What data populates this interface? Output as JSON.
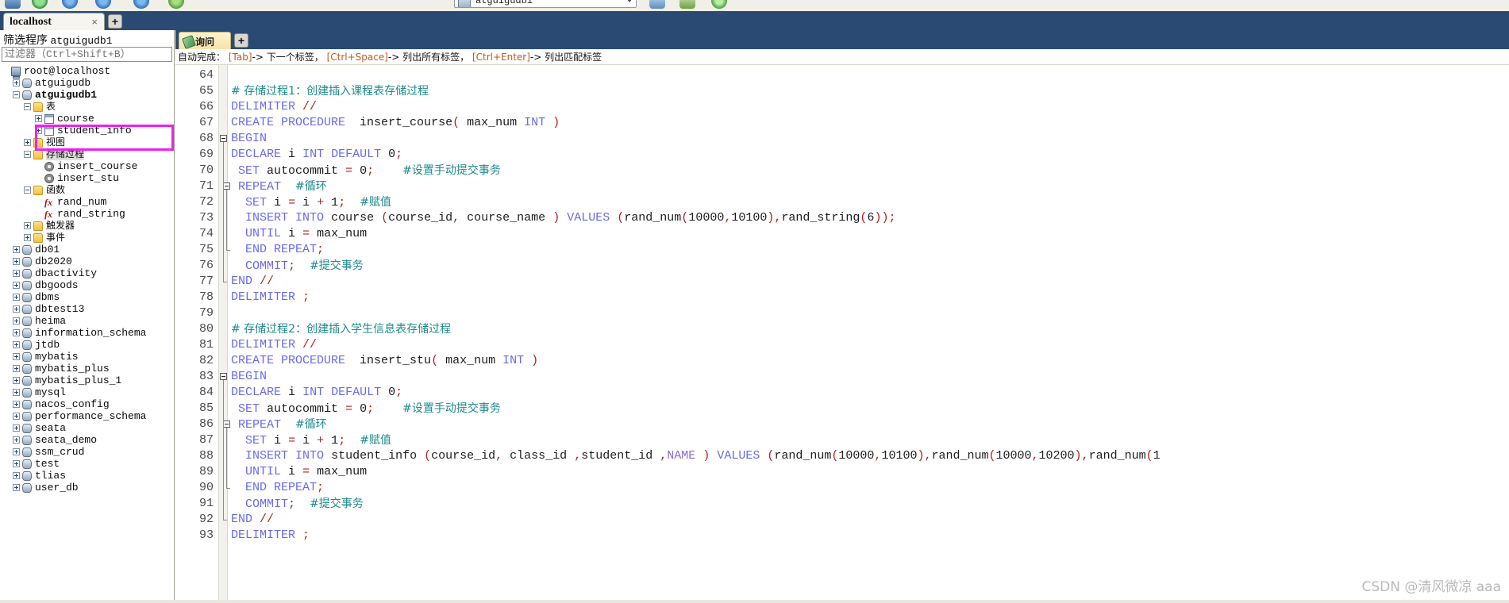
{
  "toolbar": {
    "db_combo_value": "atguigudb1",
    "icons": [
      "open-icon",
      "add-icon",
      "refresh-icon",
      "stop-icon",
      "back-icon",
      "sql-icon",
      "db-icon",
      "export-icon",
      "check-icon"
    ]
  },
  "browser_tab": {
    "label": "localhost",
    "close_label": "×",
    "new_tab_label": "+"
  },
  "sidebar": {
    "filter_title_prefix": "筛选程序",
    "filter_title_value": "atguigudb1",
    "filter_placeholder": "过滤器（Ctrl+Shift+B）",
    "filter_value": "",
    "tree": [
      {
        "label": "root@localhost",
        "indent": 0,
        "icon": "server-icon",
        "expander": "none",
        "bold": false,
        "cjk": false,
        "selected": false
      },
      {
        "label": "atguigudb",
        "indent": 1,
        "icon": "database-icon",
        "expander": "plus",
        "bold": false,
        "cjk": false,
        "selected": false
      },
      {
        "label": "atguigudb1",
        "indent": 1,
        "icon": "database-icon",
        "expander": "minus",
        "bold": true,
        "cjk": false,
        "selected": false
      },
      {
        "label": "表",
        "indent": 2,
        "icon": "folder-icon",
        "expander": "minus",
        "bold": false,
        "cjk": true,
        "selected": false
      },
      {
        "label": "course",
        "indent": 3,
        "icon": "table-icon",
        "expander": "plus",
        "bold": false,
        "cjk": false,
        "selected": false
      },
      {
        "label": "student_info",
        "indent": 3,
        "icon": "table-icon",
        "expander": "plus",
        "bold": false,
        "cjk": false,
        "selected": false
      },
      {
        "label": "视图",
        "indent": 2,
        "icon": "folder-icon",
        "expander": "plus",
        "bold": false,
        "cjk": true,
        "selected": false
      },
      {
        "label": "存储过程",
        "indent": 2,
        "icon": "folder-icon",
        "expander": "minus",
        "bold": false,
        "cjk": true,
        "selected": true
      },
      {
        "label": "insert_course",
        "indent": 3,
        "icon": "procedure-icon",
        "expander": "none",
        "bold": false,
        "cjk": false,
        "selected": false
      },
      {
        "label": "insert_stu",
        "indent": 3,
        "icon": "procedure-icon",
        "expander": "none",
        "bold": false,
        "cjk": false,
        "selected": false
      },
      {
        "label": "函数",
        "indent": 2,
        "icon": "folder-icon",
        "expander": "minus",
        "bold": false,
        "cjk": true,
        "selected": false
      },
      {
        "label": "rand_num",
        "indent": 3,
        "icon": "function-icon",
        "expander": "none",
        "bold": false,
        "cjk": false,
        "selected": false
      },
      {
        "label": "rand_string",
        "indent": 3,
        "icon": "function-icon",
        "expander": "none",
        "bold": false,
        "cjk": false,
        "selected": false
      },
      {
        "label": "触发器",
        "indent": 2,
        "icon": "folder-icon",
        "expander": "plus",
        "bold": false,
        "cjk": true,
        "selected": false
      },
      {
        "label": "事件",
        "indent": 2,
        "icon": "folder-icon",
        "expander": "plus",
        "bold": false,
        "cjk": true,
        "selected": false
      },
      {
        "label": "db01",
        "indent": 1,
        "icon": "database-icon",
        "expander": "plus",
        "bold": false,
        "cjk": false,
        "selected": false
      },
      {
        "label": "db2020",
        "indent": 1,
        "icon": "database-icon",
        "expander": "plus",
        "bold": false,
        "cjk": false,
        "selected": false
      },
      {
        "label": "dbactivity",
        "indent": 1,
        "icon": "database-icon",
        "expander": "plus",
        "bold": false,
        "cjk": false,
        "selected": false
      },
      {
        "label": "dbgoods",
        "indent": 1,
        "icon": "database-icon",
        "expander": "plus",
        "bold": false,
        "cjk": false,
        "selected": false
      },
      {
        "label": "dbms",
        "indent": 1,
        "icon": "database-icon",
        "expander": "plus",
        "bold": false,
        "cjk": false,
        "selected": false
      },
      {
        "label": "dbtest13",
        "indent": 1,
        "icon": "database-icon",
        "expander": "plus",
        "bold": false,
        "cjk": false,
        "selected": false
      },
      {
        "label": "heima",
        "indent": 1,
        "icon": "database-icon",
        "expander": "plus",
        "bold": false,
        "cjk": false,
        "selected": false
      },
      {
        "label": "information_schema",
        "indent": 1,
        "icon": "database-icon",
        "expander": "plus",
        "bold": false,
        "cjk": false,
        "selected": false
      },
      {
        "label": "jtdb",
        "indent": 1,
        "icon": "database-icon",
        "expander": "plus",
        "bold": false,
        "cjk": false,
        "selected": false
      },
      {
        "label": "mybatis",
        "indent": 1,
        "icon": "database-icon",
        "expander": "plus",
        "bold": false,
        "cjk": false,
        "selected": false
      },
      {
        "label": "mybatis_plus",
        "indent": 1,
        "icon": "database-icon",
        "expander": "plus",
        "bold": false,
        "cjk": false,
        "selected": false
      },
      {
        "label": "mybatis_plus_1",
        "indent": 1,
        "icon": "database-icon",
        "expander": "plus",
        "bold": false,
        "cjk": false,
        "selected": false
      },
      {
        "label": "mysql",
        "indent": 1,
        "icon": "database-icon",
        "expander": "plus",
        "bold": false,
        "cjk": false,
        "selected": false
      },
      {
        "label": "nacos_config",
        "indent": 1,
        "icon": "database-icon",
        "expander": "plus",
        "bold": false,
        "cjk": false,
        "selected": false
      },
      {
        "label": "performance_schema",
        "indent": 1,
        "icon": "database-icon",
        "expander": "plus",
        "bold": false,
        "cjk": false,
        "selected": false
      },
      {
        "label": "seata",
        "indent": 1,
        "icon": "database-icon",
        "expander": "plus",
        "bold": false,
        "cjk": false,
        "selected": false
      },
      {
        "label": "seata_demo",
        "indent": 1,
        "icon": "database-icon",
        "expander": "plus",
        "bold": false,
        "cjk": false,
        "selected": false
      },
      {
        "label": "ssm_crud",
        "indent": 1,
        "icon": "database-icon",
        "expander": "plus",
        "bold": false,
        "cjk": false,
        "selected": false
      },
      {
        "label": "test",
        "indent": 1,
        "icon": "database-icon",
        "expander": "plus",
        "bold": false,
        "cjk": false,
        "selected": false
      },
      {
        "label": "tlias",
        "indent": 1,
        "icon": "database-icon",
        "expander": "plus",
        "bold": false,
        "cjk": false,
        "selected": false
      },
      {
        "label": "user_db",
        "indent": 1,
        "icon": "database-icon",
        "expander": "plus",
        "bold": false,
        "cjk": false,
        "selected": false
      }
    ],
    "highlight_color": "#ec22ec"
  },
  "query_tab": {
    "label": "询问",
    "new_tab_label": "+"
  },
  "hint_bar": {
    "prefix": "自动完成：",
    "parts": [
      {
        "key": "[Tab]",
        "text": "-> 下一个标签，"
      },
      {
        "key": "[Ctrl+Space]",
        "text": "-> 列出所有标签，"
      },
      {
        "key": "[Ctrl+Enter]",
        "text": "-> 列出匹配标签"
      }
    ]
  },
  "editor": {
    "first_line_number": 64,
    "lines": [
      {
        "n": 64,
        "html": ""
      },
      {
        "n": 65,
        "html": "<span class=\"cmt\"># 存储过程1：创建插入课程表存储过程</span>"
      },
      {
        "n": 66,
        "html": "<span class=\"kw2\">DELIMITER</span> <span class=\"punc\">//</span>"
      },
      {
        "n": 67,
        "html": "<span class=\"kw2\">CREATE PROCEDURE</span>&nbsp;&nbsp;<span class=\"ident\">insert_course</span><span class=\"punc\">(</span> <span class=\"ident\">max_num</span> <span class=\"kw2\">INT</span> <span class=\"punc\">)</span>"
      },
      {
        "n": 68,
        "html": "<span class=\"kw2\">BEGIN</span>",
        "fold": "start"
      },
      {
        "n": 69,
        "html": "<span class=\"kw2\">DECLARE</span> <span class=\"ident\">i</span> <span class=\"kw2\">INT DEFAULT</span> <span class=\"ident\">0</span><span class=\"punc\">;</span>",
        "fold": "line"
      },
      {
        "n": 70,
        "html": "&nbsp;<span class=\"kw2\">SET</span> <span class=\"ident\">autocommit</span> <span class=\"punc\">=</span> <span class=\"ident\">0</span><span class=\"punc\">;</span>&nbsp;&nbsp;&nbsp;&nbsp;<span class=\"cmt\">#设置手动提交事务</span>",
        "fold": "line"
      },
      {
        "n": 71,
        "html": "&nbsp;<span class=\"kw2\">REPEAT</span>&nbsp;&nbsp;<span class=\"cmt\">#循环</span>",
        "fold": "start2"
      },
      {
        "n": 72,
        "html": "&nbsp;&nbsp;<span class=\"kw2\">SET</span> <span class=\"ident\">i</span> <span class=\"punc\">=</span> <span class=\"ident\">i</span> <span class=\"punc\">+</span> <span class=\"ident\">1</span><span class=\"punc\">;</span>&nbsp;&nbsp;<span class=\"cmt\">#赋值</span>",
        "fold": "line2"
      },
      {
        "n": 73,
        "html": "&nbsp;&nbsp;<span class=\"kw2\">INSERT INTO</span> <span class=\"ident\">course</span> <span class=\"punc\">(</span><span class=\"ident\">course_id</span><span class=\"punc\">,</span> <span class=\"ident\">course_name</span> <span class=\"punc\">)</span> <span class=\"kw2\">VALUES</span> <span class=\"punc\">(</span><span class=\"ident\">rand_num</span><span class=\"punc\">(</span><span class=\"ident\">10000</span><span class=\"punc\">,</span><span class=\"ident\">10100</span><span class=\"punc\">),</span><span class=\"ident\">rand_string</span><span class=\"punc\">(</span><span class=\"ident\">6</span><span class=\"punc\">));</span>",
        "fold": "line2"
      },
      {
        "n": 74,
        "html": "&nbsp;&nbsp;<span class=\"kw2\">UNTIL</span> <span class=\"ident\">i</span> <span class=\"punc\">=</span> <span class=\"ident\">max_num</span>",
        "fold": "line2"
      },
      {
        "n": 75,
        "html": "&nbsp;&nbsp;<span class=\"kw2\">END REPEAT</span><span class=\"punc\">;</span>",
        "fold": "end2"
      },
      {
        "n": 76,
        "html": "&nbsp;&nbsp;<span class=\"kw2\">COMMIT</span><span class=\"punc\">;</span>&nbsp;&nbsp;<span class=\"cmt\">#提交事务</span>",
        "fold": "line"
      },
      {
        "n": 77,
        "html": "<span class=\"kw2\">END</span> <span class=\"punc\">//</span>",
        "fold": "end"
      },
      {
        "n": 78,
        "html": "<span class=\"kw2\">DELIMITER</span> <span class=\"punc\">;</span>"
      },
      {
        "n": 79,
        "html": ""
      },
      {
        "n": 80,
        "html": "<span class=\"cmt\"># 存储过程2：创建插入学生信息表存储过程</span>"
      },
      {
        "n": 81,
        "html": "<span class=\"kw2\">DELIMITER</span> <span class=\"punc\">//</span>"
      },
      {
        "n": 82,
        "html": "<span class=\"kw2\">CREATE PROCEDURE</span>&nbsp;&nbsp;<span class=\"ident\">insert_stu</span><span class=\"punc\">(</span> <span class=\"ident\">max_num</span> <span class=\"kw2\">INT</span> <span class=\"punc\">)</span>"
      },
      {
        "n": 83,
        "html": "<span class=\"kw2\">BEGIN</span>",
        "fold": "start"
      },
      {
        "n": 84,
        "html": "<span class=\"kw2\">DECLARE</span> <span class=\"ident\">i</span> <span class=\"kw2\">INT DEFAULT</span> <span class=\"ident\">0</span><span class=\"punc\">;</span>",
        "fold": "line"
      },
      {
        "n": 85,
        "html": "&nbsp;<span class=\"kw2\">SET</span> <span class=\"ident\">autocommit</span> <span class=\"punc\">=</span> <span class=\"ident\">0</span><span class=\"punc\">;</span>&nbsp;&nbsp;&nbsp;&nbsp;<span class=\"cmt\">#设置手动提交事务</span>",
        "fold": "line"
      },
      {
        "n": 86,
        "html": "&nbsp;<span class=\"kw2\">REPEAT</span>&nbsp;&nbsp;<span class=\"cmt\">#循环</span>",
        "fold": "start2"
      },
      {
        "n": 87,
        "html": "&nbsp;&nbsp;<span class=\"kw2\">SET</span> <span class=\"ident\">i</span> <span class=\"punc\">=</span> <span class=\"ident\">i</span> <span class=\"punc\">+</span> <span class=\"ident\">1</span><span class=\"punc\">;</span>&nbsp;&nbsp;<span class=\"cmt\">#赋值</span>",
        "fold": "line2"
      },
      {
        "n": 88,
        "html": "&nbsp;&nbsp;<span class=\"kw2\">INSERT INTO</span> <span class=\"ident\">student_info</span> <span class=\"punc\">(</span><span class=\"ident\">course_id</span><span class=\"punc\">,</span> <span class=\"ident\">class_id</span> <span class=\"punc\">,</span><span class=\"ident\">student_id</span> <span class=\"punc\">,</span><span class=\"nm\">NAME</span> <span class=\"punc\">)</span> <span class=\"kw2\">VALUES</span> <span class=\"punc\">(</span><span class=\"ident\">rand_num</span><span class=\"punc\">(</span><span class=\"ident\">10000</span><span class=\"punc\">,</span><span class=\"ident\">10100</span><span class=\"punc\">),</span><span class=\"ident\">rand_num</span><span class=\"punc\">(</span><span class=\"ident\">10000</span><span class=\"punc\">,</span><span class=\"ident\">10200</span><span class=\"punc\">),</span><span class=\"ident\">rand_num</span><span class=\"punc\">(</span><span class=\"ident\">1</span>",
        "fold": "line2"
      },
      {
        "n": 89,
        "html": "&nbsp;&nbsp;<span class=\"kw2\">UNTIL</span> <span class=\"ident\">i</span> <span class=\"punc\">=</span> <span class=\"ident\">max_num</span>",
        "fold": "line2"
      },
      {
        "n": 90,
        "html": "&nbsp;&nbsp;<span class=\"kw2\">END REPEAT</span><span class=\"punc\">;</span>",
        "fold": "end2"
      },
      {
        "n": 91,
        "html": "&nbsp;&nbsp;<span class=\"kw2\">COMMIT</span><span class=\"punc\">;</span>&nbsp;&nbsp;<span class=\"cmt\">#提交事务</span>",
        "fold": "line"
      },
      {
        "n": 92,
        "html": "<span class=\"kw2\">END</span> <span class=\"punc\">//</span>",
        "fold": "end"
      },
      {
        "n": 93,
        "html": "<span class=\"kw2\">DELIMITER</span> <span class=\"punc\">;</span>"
      }
    ]
  },
  "watermark": {
    "text": "CSDN @清风微凉 aaa"
  }
}
